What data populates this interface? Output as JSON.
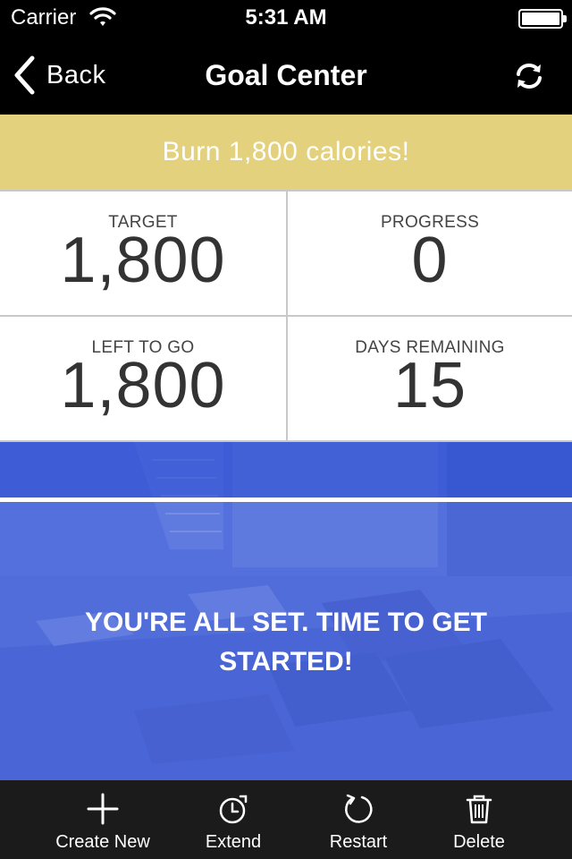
{
  "status_bar": {
    "carrier": "Carrier",
    "time": "5:31 AM"
  },
  "nav": {
    "back_label": "Back",
    "title": "Goal Center",
    "refresh_icon": "refresh-icon"
  },
  "goal": {
    "text": "Burn 1,800 calories!",
    "banner_color": "#e3d17d"
  },
  "stats": {
    "target": {
      "label": "TARGET",
      "value": "1,800"
    },
    "progress": {
      "label": "PROGRESS",
      "value": "0"
    },
    "left_to_go": {
      "label": "LEFT TO GO",
      "value": "1,800"
    },
    "days_remaining": {
      "label": "DAYS REMAINING",
      "value": "15"
    }
  },
  "hero": {
    "message": "YOU'RE ALL SET. TIME TO GET STARTED!",
    "overlay_color": "#4a67d8"
  },
  "toolbar": {
    "create_new": "Create New",
    "extend": "Extend",
    "restart": "Restart",
    "delete": "Delete"
  }
}
